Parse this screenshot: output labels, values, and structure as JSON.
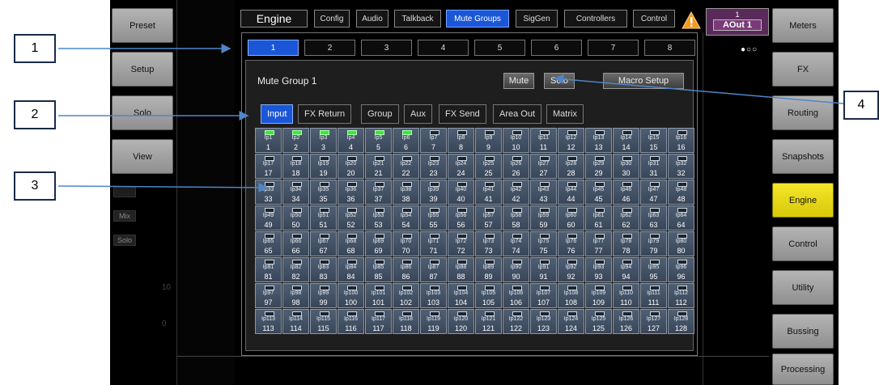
{
  "callouts": [
    "1",
    "2",
    "3",
    "4"
  ],
  "left_buttons": [
    "Preset",
    "Setup",
    "Solo",
    "View"
  ],
  "left_strip_labels": [
    "Mix",
    "Solo"
  ],
  "scale_labels": [
    "10",
    "0"
  ],
  "top_tabs": {
    "title": "Engine",
    "items": [
      "Config",
      "Audio",
      "Talkback",
      "Mute Groups",
      "SigGen",
      "Controllers",
      "Control"
    ],
    "active": "Mute Groups"
  },
  "warning_icon": "warning-triangle-icon",
  "output_badge": {
    "number": "1",
    "label": "AOut 1"
  },
  "right_buttons": [
    "Meters",
    "FX",
    "Routing",
    "Snapshots",
    "Engine",
    "Control",
    "Utility",
    "Bussing",
    "Processing"
  ],
  "right_active": "Engine",
  "page_indicator": "●○○",
  "group_tabs": [
    "1",
    "2",
    "3",
    "4",
    "5",
    "6",
    "7",
    "8"
  ],
  "group_active": "1",
  "group_title": "Mute Group 1",
  "mute_label": "Mute",
  "solo_label": "Solo",
  "macro_label": "Macro Setup",
  "source_tabs": [
    "Input",
    "FX Return",
    "Group",
    "Aux",
    "FX Send",
    "Area Out",
    "Matrix"
  ],
  "source_active": "Input",
  "channel_prefix": "Ip",
  "channel_count": 128,
  "lit_channels": [
    1,
    2,
    3,
    4,
    5,
    6
  ]
}
